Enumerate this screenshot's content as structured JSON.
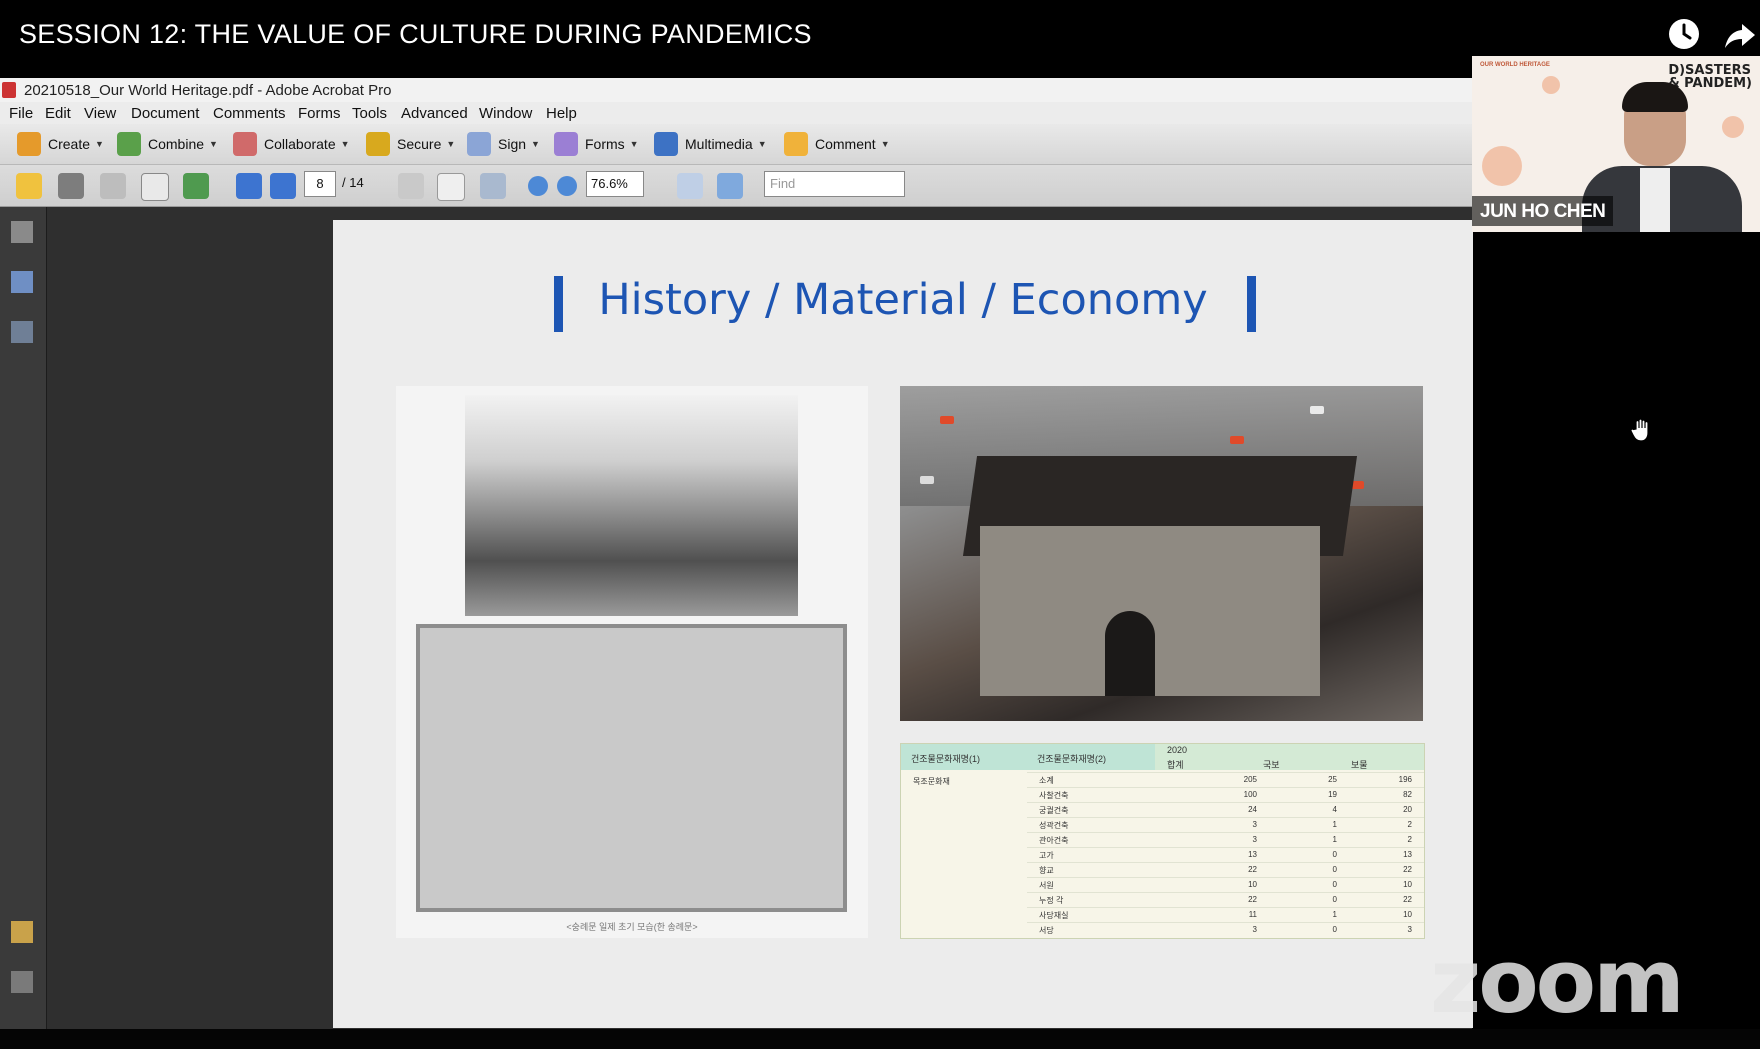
{
  "video": {
    "title": "SESSION 12: THE VALUE OF CULTURE DURING PANDEMICS",
    "icons": [
      "clock-icon",
      "share-icon"
    ]
  },
  "acrobat": {
    "window_title": "20210518_Our World Heritage.pdf - Adobe Acrobat Pro",
    "menu": [
      "File",
      "Edit",
      "View",
      "Document",
      "Comments",
      "Forms",
      "Tools",
      "Advanced",
      "Window",
      "Help"
    ],
    "toolbar": [
      "Create",
      "Combine",
      "Collaborate",
      "Secure",
      "Sign",
      "Forms",
      "Multimedia",
      "Comment"
    ],
    "page_current": "8",
    "page_total": "/ 14",
    "zoom": "76.6%",
    "find_placeholder": "Find"
  },
  "slide": {
    "title": "History / Material / Economy",
    "photo_caption": "<숭례문 일제 초기 모습(한 송례문>",
    "table": {
      "header_col1": "건조물문화재명(1)",
      "header_col2": "건조물문화재명(2)",
      "year": "2020",
      "col_total": "합계",
      "col_national": "국보",
      "col_treasure": "보물",
      "category": "목조문화재",
      "rows": [
        {
          "name": "소계",
          "v1": "205",
          "v2": "25",
          "v3": "196"
        },
        {
          "name": "사찰건축",
          "v1": "100",
          "v2": "19",
          "v3": "82"
        },
        {
          "name": "궁궐건축",
          "v1": "24",
          "v2": "4",
          "v3": "20"
        },
        {
          "name": "성곽건축",
          "v1": "3",
          "v2": "1",
          "v3": "2"
        },
        {
          "name": "관아건축",
          "v1": "3",
          "v2": "1",
          "v3": "2"
        },
        {
          "name": "고가",
          "v1": "13",
          "v2": "0",
          "v3": "13"
        },
        {
          "name": "향교",
          "v1": "22",
          "v2": "0",
          "v3": "22"
        },
        {
          "name": "서원",
          "v1": "10",
          "v2": "0",
          "v3": "10"
        },
        {
          "name": "누정 각",
          "v1": "22",
          "v2": "0",
          "v3": "22"
        },
        {
          "name": "사당재실",
          "v1": "11",
          "v2": "1",
          "v3": "10"
        },
        {
          "name": "서당",
          "v1": "3",
          "v2": "0",
          "v3": "3"
        }
      ]
    }
  },
  "speaker": {
    "name": "JUN HO CHEN",
    "logo": "OUR WORLD HERITAGE",
    "brand_line1": "D)SASTERS",
    "brand_line2": "& PANDEM)"
  },
  "watermark": "zoom"
}
